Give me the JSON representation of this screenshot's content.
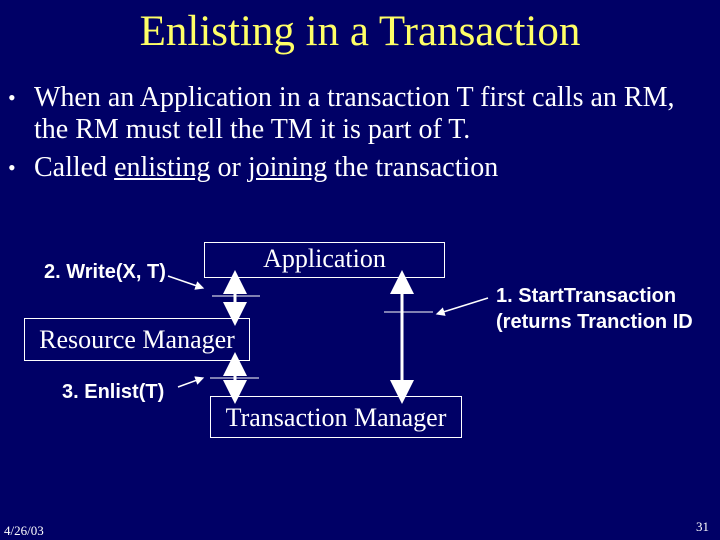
{
  "slide": {
    "title": "Enlisting in a Transaction",
    "bullets": [
      {
        "line1": "When an Application in a transaction T first calls an RM,",
        "line2": "the RM must tell the TM it is part of T."
      },
      {
        "pre": "Called ",
        "u1": "enlisting",
        "mid": " or ",
        "u2": "joining",
        "post": " the transaction"
      }
    ],
    "bullet_glyph": "•",
    "diagram": {
      "boxes": {
        "application": "Application",
        "resource_manager": "Resource Manager",
        "transaction_manager": "Transaction Manager"
      },
      "labels": {
        "write": "2. Write(X, T)",
        "enlist": "3. Enlist(T)",
        "start_line1": "1. StartTransaction",
        "start_line2": "(returns Tranction ID"
      }
    },
    "footer": {
      "date": "4/26/03",
      "page_number": "31"
    },
    "colors": {
      "background": "#000066",
      "title": "#ffff66",
      "text": "#ffffff"
    }
  }
}
